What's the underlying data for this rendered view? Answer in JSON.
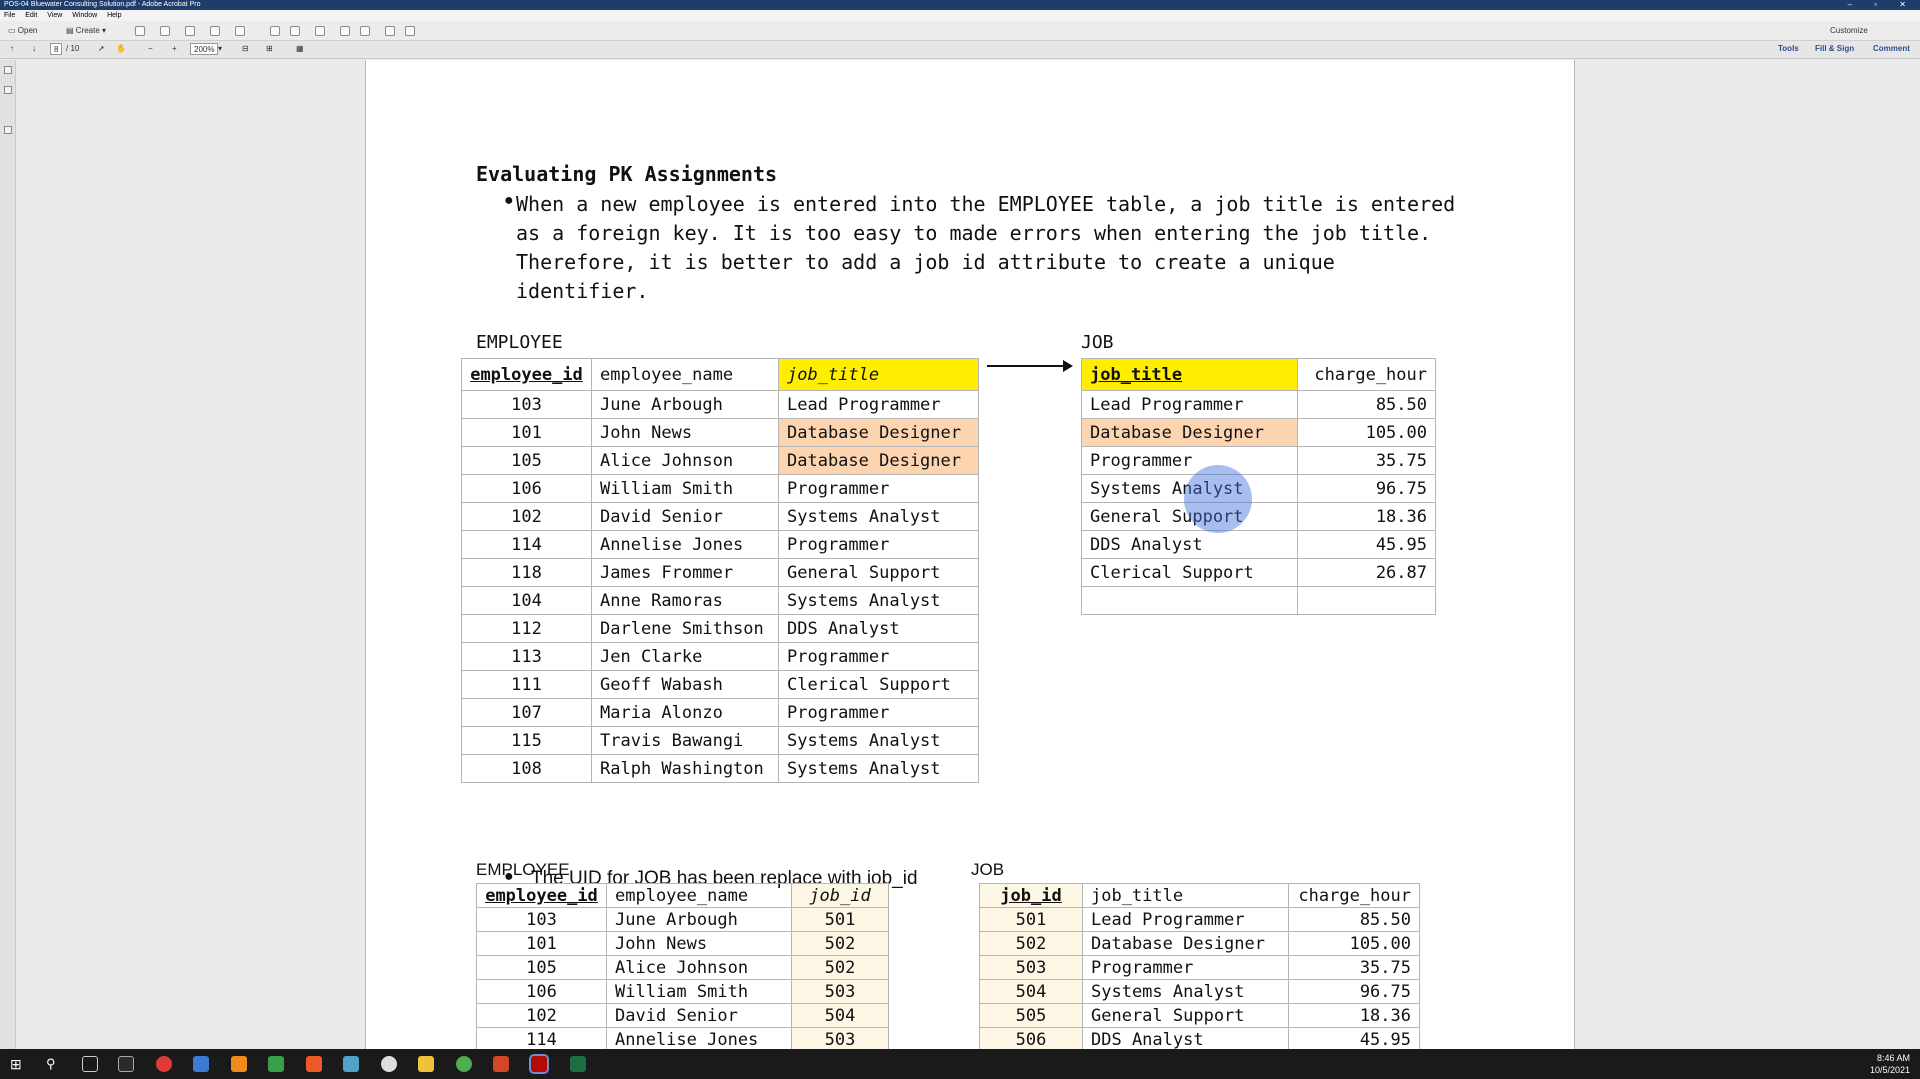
{
  "window": {
    "title": "POS-04 Bluewater Consulting Solution.pdf - Adobe Acrobat Pro"
  },
  "menu": [
    "File",
    "Edit",
    "View",
    "Window",
    "Help"
  ],
  "toolbar": {
    "open_label": "Open",
    "create_label": "Create",
    "customize_label": "Customize"
  },
  "nav": {
    "page_current": "8",
    "page_total": "/ 10",
    "zoom": "200%"
  },
  "right_tools": {
    "tools": "Tools",
    "fill_sign": "Fill & Sign",
    "comment": "Comment"
  },
  "doc": {
    "heading": "Evaluating PK Assignments",
    "bullet1": "When a new employee is entered into the EMPLOYEE table, a job title is entered as a foreign key. It is too easy to made errors when entering the job title. Therefore, it is better to add a job id attribute to create a unique identifier.",
    "bullet2": "The UID for JOB has been replace with job_id"
  },
  "emp1": {
    "label": "EMPLOYEE",
    "headers": [
      "employee_id",
      "employee_name",
      "job_title"
    ],
    "rows": [
      [
        "103",
        "June Arbough",
        "Lead Programmer"
      ],
      [
        "101",
        "John News",
        "Database Designer"
      ],
      [
        "105",
        "Alice Johnson",
        "Database Designer"
      ],
      [
        "106",
        "William Smith",
        "Programmer"
      ],
      [
        "102",
        "David Senior",
        "Systems Analyst"
      ],
      [
        "114",
        "Annelise Jones",
        "Programmer"
      ],
      [
        "118",
        "James Frommer",
        "General Support"
      ],
      [
        "104",
        "Anne Ramoras",
        "Systems Analyst"
      ],
      [
        "112",
        "Darlene Smithson",
        "DDS Analyst"
      ],
      [
        "113",
        "Jen Clarke",
        "Programmer"
      ],
      [
        "111",
        "Geoff Wabash",
        "Clerical Support"
      ],
      [
        "107",
        "Maria Alonzo",
        "Programmer"
      ],
      [
        "115",
        "Travis Bawangi",
        "Systems Analyst"
      ],
      [
        "108",
        "Ralph Washington",
        "Systems Analyst"
      ]
    ]
  },
  "job1": {
    "label": "JOB",
    "headers": [
      "job_title",
      "charge_hour"
    ],
    "rows": [
      [
        "Lead Programmer",
        "85.50"
      ],
      [
        "Database Designer",
        "105.00"
      ],
      [
        "Programmer",
        "35.75"
      ],
      [
        "Systems Analyst",
        "96.75"
      ],
      [
        "General Support",
        "18.36"
      ],
      [
        "DDS Analyst",
        "45.95"
      ],
      [
        "Clerical Support",
        "26.87"
      ],
      [
        "",
        ""
      ]
    ]
  },
  "emp2": {
    "label": "EMPLOYEE",
    "headers": [
      "employee_id",
      "employee_name",
      "job_id"
    ],
    "rows": [
      [
        "103",
        "June Arbough",
        "501"
      ],
      [
        "101",
        "John News",
        "502"
      ],
      [
        "105",
        "Alice Johnson",
        "502"
      ],
      [
        "106",
        "William Smith",
        "503"
      ],
      [
        "102",
        "David Senior",
        "504"
      ],
      [
        "114",
        "Annelise Jones",
        "503"
      ]
    ]
  },
  "job2": {
    "label": "JOB",
    "headers": [
      "job_id",
      "job_title",
      "charge_hour"
    ],
    "rows": [
      [
        "501",
        "Lead Programmer",
        "85.50"
      ],
      [
        "502",
        "Database Designer",
        "105.00"
      ],
      [
        "503",
        "Programmer",
        "35.75"
      ],
      [
        "504",
        "Systems Analyst",
        "96.75"
      ],
      [
        "505",
        "General Support",
        "18.36"
      ],
      [
        "506",
        "DDS Analyst",
        "45.95"
      ]
    ]
  },
  "clock": {
    "time": "8:46 AM",
    "date": "10/5/2021"
  }
}
